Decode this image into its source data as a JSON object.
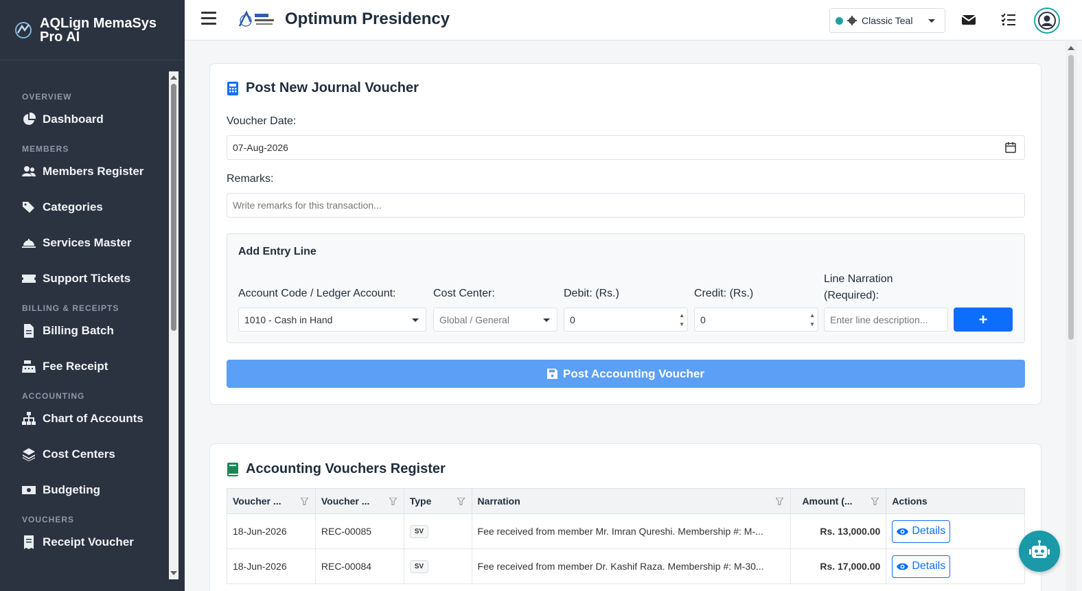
{
  "app": {
    "name": "AQLign MemaSys Pro AI",
    "org_title": "Optimum Presidency"
  },
  "sidebar": {
    "sections": [
      {
        "title": "OVERVIEW",
        "items": [
          {
            "label": "Dashboard",
            "icon": "chart-pie-icon"
          }
        ]
      },
      {
        "title": "MEMBERS",
        "items": [
          {
            "label": "Members Register",
            "icon": "users-icon"
          },
          {
            "label": "Categories",
            "icon": "tags-icon"
          },
          {
            "label": "Services Master",
            "icon": "service-bell-icon"
          },
          {
            "label": "Support Tickets",
            "icon": "ticket-icon"
          }
        ]
      },
      {
        "title": "BILLING & RECEIPTS",
        "items": [
          {
            "label": "Billing Batch",
            "icon": "file-invoice-icon"
          },
          {
            "label": "Fee Receipt",
            "icon": "cash-register-icon"
          }
        ]
      },
      {
        "title": "ACCOUNTING",
        "items": [
          {
            "label": "Chart of Accounts",
            "icon": "sitemap-icon"
          },
          {
            "label": "Cost Centers",
            "icon": "layers-icon"
          },
          {
            "label": "Budgeting",
            "icon": "money-bill-icon"
          }
        ]
      },
      {
        "title": "VOUCHERS",
        "items": [
          {
            "label": "Receipt Voucher",
            "icon": "receipt-icon"
          }
        ]
      }
    ]
  },
  "topbar": {
    "theme": {
      "label": "Classic Teal",
      "accent": "#1aa3a3"
    }
  },
  "form": {
    "title": "Post New Journal Voucher",
    "voucher_date_label": "Voucher Date:",
    "voucher_date_value": "07-Aug-2026",
    "remarks_label": "Remarks:",
    "remarks_placeholder": "Write remarks for this transaction...",
    "entry": {
      "title": "Add Entry Line",
      "account_label": "Account Code / Ledger Account:",
      "account_value": "1010 - Cash in Hand",
      "cost_center_label": "Cost Center:",
      "cost_center_value": "Global / General",
      "debit_label": "Debit: (Rs.)",
      "debit_value": "0",
      "credit_label": "Credit: (Rs.)",
      "credit_value": "0",
      "narration_label_1": "Line Narration",
      "narration_label_2": "(Required):",
      "narration_placeholder": "Enter line description...",
      "add_label": "+"
    },
    "post_label": "Post Accounting Voucher"
  },
  "register": {
    "title": "Accounting Vouchers Register",
    "columns": [
      "Voucher ...",
      "Voucher ...",
      "Type",
      "Narration",
      "Amount (...",
      "Actions"
    ],
    "rows": [
      {
        "date": "18-Jun-2026",
        "no": "REC-00085",
        "type": "SV",
        "narration": "Fee received from member Mr. Imran Qureshi. Membership #: M-...",
        "amount": "Rs. 13,000.00",
        "action": "Details"
      },
      {
        "date": "18-Jun-2026",
        "no": "REC-00084",
        "type": "SV",
        "narration": "Fee received from member Dr. Kashif Raza. Membership #: M-30...",
        "amount": "Rs. 17,000.00",
        "action": "Details"
      }
    ]
  }
}
